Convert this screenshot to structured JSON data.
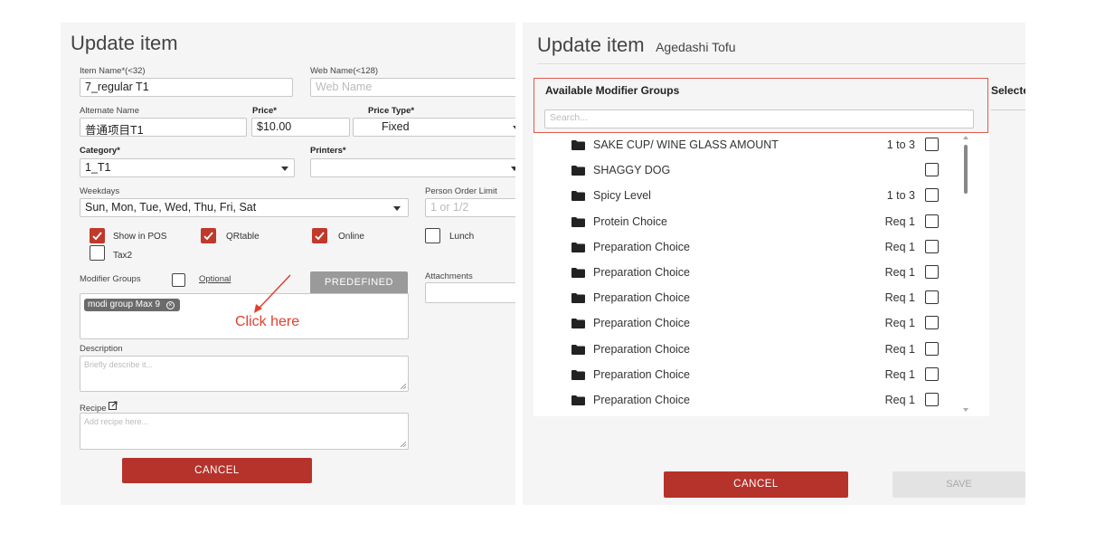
{
  "left": {
    "title": "Update item",
    "item_name": {
      "label": "Item Name*",
      "hint": "(<32)",
      "value": "7_regular T1"
    },
    "web_name": {
      "label": "Web Name(<128)",
      "placeholder": "Web Name"
    },
    "alternate_name": {
      "label": "Alternate Name",
      "value": "普通项目T1"
    },
    "price": {
      "label": "Price*",
      "value": "$10.00"
    },
    "price_type": {
      "label": "Price Type*",
      "value": "Fixed"
    },
    "category": {
      "label": "Category*",
      "value": "1_T1"
    },
    "printers": {
      "label": "Printers*",
      "value": ""
    },
    "weekdays": {
      "label": "Weekdays",
      "value": "Sun, Mon, Tue, Wed, Thu, Fri, Sat"
    },
    "person_order_limit": {
      "label": "Person Order Limit",
      "placeholder": "1 or 1/2"
    },
    "checkboxes": [
      {
        "label": "Show in POS",
        "checked": true
      },
      {
        "label": "QRtable",
        "checked": true
      },
      {
        "label": "Online",
        "checked": true
      },
      {
        "label": "Lunch",
        "checked": false
      },
      {
        "label": "Tax2",
        "checked": false
      }
    ],
    "modifier_groups": {
      "label": "Modifier Groups",
      "optional_label": "Optional",
      "optional_checked": false,
      "predefined_label": "PREDEFINED",
      "tag": "modi group Max 9"
    },
    "annotation": "Click here",
    "attachments": {
      "label": "Attachments"
    },
    "description": {
      "label": "Description",
      "placeholder": "Briefly describe it..."
    },
    "recipe": {
      "label": "Recipe",
      "placeholder": "Add recipe here..."
    },
    "cancel_label": "CANCEL"
  },
  "right": {
    "title": "Update item",
    "subtitle": "Agedashi Tofu",
    "available_header": "Available Modifier Groups",
    "selected_header": "Selecte",
    "search_placeholder": "Search...",
    "modifiers": [
      {
        "name": "SAKE CUP/ WINE GLASS AMOUNT",
        "rule": "1 to 3"
      },
      {
        "name": "SHAGGY DOG",
        "rule": ""
      },
      {
        "name": "Spicy Level",
        "rule": "1 to 3"
      },
      {
        "name": "Protein Choice",
        "rule": "Req 1"
      },
      {
        "name": "Preparation Choice",
        "rule": "Req 1"
      },
      {
        "name": "Preparation Choice",
        "rule": "Req 1"
      },
      {
        "name": "Preparation Choice",
        "rule": "Req 1"
      },
      {
        "name": "Preparation Choice",
        "rule": "Req 1"
      },
      {
        "name": "Preparation Choice",
        "rule": "Req 1"
      },
      {
        "name": "Preparation Choice",
        "rule": "Req 1"
      },
      {
        "name": "Preparation Choice",
        "rule": "Req 1"
      }
    ],
    "cancel_label": "CANCEL",
    "save_label": "SAVE"
  },
  "colors": {
    "accent_red": "#b5332b",
    "highlight_border": "#e05a4e",
    "annotation_red": "#e0402f",
    "check_red": "#c0392b"
  },
  "icons": {
    "folder": "folder-icon",
    "checkmark": "checkmark-icon",
    "external_link": "external-link-icon",
    "tag_close": "close-circle-icon"
  }
}
